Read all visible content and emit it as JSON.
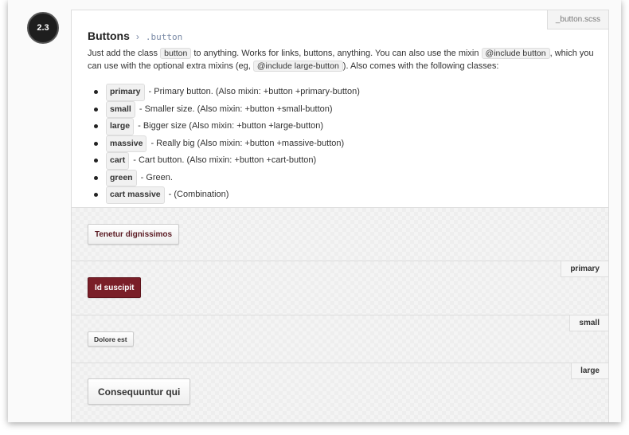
{
  "section": {
    "number": "2.3"
  },
  "doc": {
    "file": "_button.scss",
    "title": "Buttons",
    "separator": "›",
    "selector": ".button",
    "desc": {
      "t1": "Just add the class ",
      "c1": "button",
      "t2": " to anything. Works for links, buttons, anything. You can also use the mixin ",
      "c2": "@include button",
      "t3": ", which you can use with the optional extra mixins (eg, ",
      "c3": "@include large-button",
      "t4": "). Also comes with the following classes:"
    },
    "classes": [
      {
        "name": "primary",
        "text": "- Primary button. (Also mixin: +button +primary-button)"
      },
      {
        "name": "small",
        "text": "- Smaller size. (Also mixin: +button +small-button)"
      },
      {
        "name": "large",
        "text": "- Bigger size (Also mixin: +button +large-button)"
      },
      {
        "name": "massive",
        "text": "- Really big (Also mixin: +button +massive-button)"
      },
      {
        "name": "cart",
        "text": "- Cart button. (Also mixin: +button +cart-button)"
      },
      {
        "name": "green",
        "text": "- Green."
      },
      {
        "name": "cart massive",
        "text": "- (Combination)"
      }
    ]
  },
  "examples": [
    {
      "label": "",
      "button": "Tenetur dignissimos"
    },
    {
      "label": "primary",
      "button": "Id suscipit"
    },
    {
      "label": "small",
      "button": "Dolore est"
    },
    {
      "label": "large",
      "button": "Consequuntur qui"
    }
  ],
  "colors": {
    "primary": "#7a1f28",
    "badge": "#1e1e1e"
  }
}
